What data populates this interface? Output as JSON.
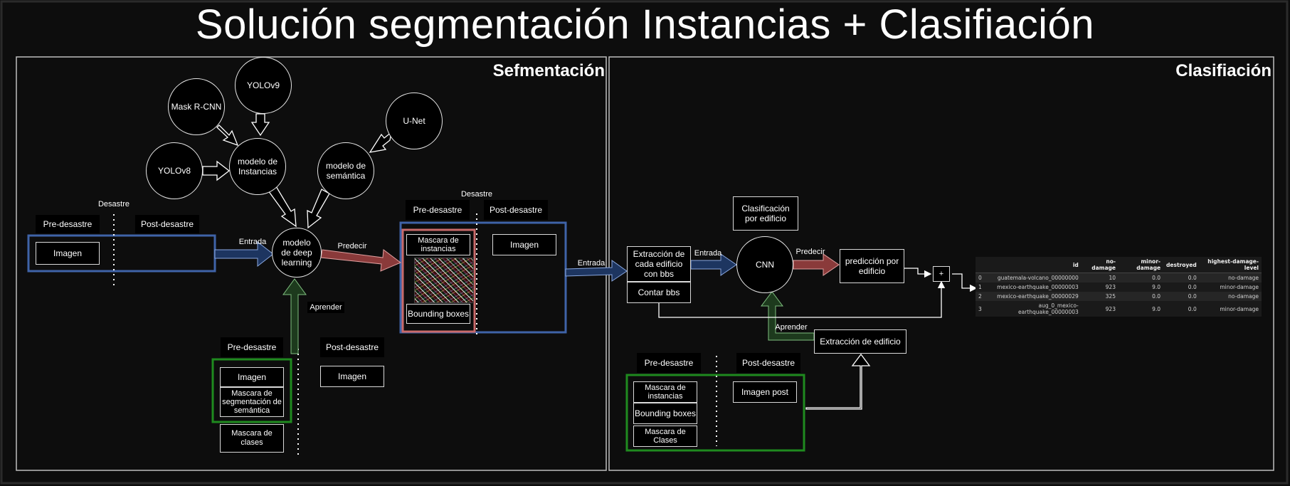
{
  "title": "Solución segmentación Instancias + Clasifiación",
  "sections": {
    "segmentation": "Sefmentación",
    "classification": "Clasifiación"
  },
  "models": {
    "yolov9": "YOLOv9",
    "mask_rcnn": "Mask R-CNN",
    "yolov8": "YOLOv8",
    "unet": "U-Net",
    "instance_model": "modelo de Instancias",
    "semantic_model": "modelo de semántica",
    "deep_learning": "modelo de deep learning",
    "cnn": "CNN"
  },
  "segmentation": {
    "input_group_title": "Desastre",
    "pre": "Pre-desastre",
    "post": "Post-desastre",
    "image": "Imagen",
    "entrada": "Entrada",
    "predecir": "Predecir",
    "aprender": "Aprender",
    "output_group_title": "Desastre",
    "out_pre": "Pre-desastre",
    "out_post": "Post-desastre",
    "mascara_instancias": "Mascara de instancias",
    "bounding_boxes": "Bounding boxes",
    "out_image": "Imagen",
    "train_pre": "Pre-desastre",
    "train_post": "Post-desastre",
    "train_image": "Imagen",
    "train_semantic_mask": "Mascara de segmentación de semántica",
    "train_class_mask": "Mascara de clases",
    "train_post_image": "Imagen"
  },
  "classification": {
    "entrada_link": "Entrada",
    "extraction": "Extracción de cada edificio con bbs",
    "count_bbs": "Contar bbs",
    "entrada": "Entrada",
    "classification_label": "Clasificación por edificio",
    "predecir": "Predecir",
    "prediction": "predicción por edificio",
    "plus": "+",
    "aprender": "Aprender",
    "building_extraction": "Extracción de edificio",
    "train_pre": "Pre-desastre",
    "train_post": "Post-desastre",
    "train_mask": "Mascara de instancias",
    "train_bbs": "Bounding boxes",
    "train_classes": "Mascara de Clases",
    "train_post_image": "Imagen post"
  },
  "result_table": {
    "columns": [
      "",
      "id",
      "no-damage",
      "minor-damage",
      "destroyed",
      "highest-damage-level"
    ],
    "rows": [
      [
        "0",
        "guatemala-volcano_00000000",
        "10",
        "0.0",
        "0.0",
        "no-damage"
      ],
      [
        "1",
        "mexico-earthquake_00000003",
        "923",
        "9.0",
        "0.0",
        "minor-damage"
      ],
      [
        "2",
        "mexico-earthquake_00000029",
        "325",
        "0.0",
        "0.0",
        "no-damage"
      ],
      [
        "3",
        "aug_0_mexico-earthquake_00000003",
        "923",
        "9.0",
        "0.0",
        "minor-damage"
      ]
    ]
  },
  "colors": {
    "blue_frame": "#3f63a8",
    "red_frame": "#c96a6a",
    "green_frame": "#1f8a1f",
    "arrow_blue": "#1d3560",
    "arrow_red": "#8a3a3a",
    "arrow_green": "#1d3a1d"
  }
}
